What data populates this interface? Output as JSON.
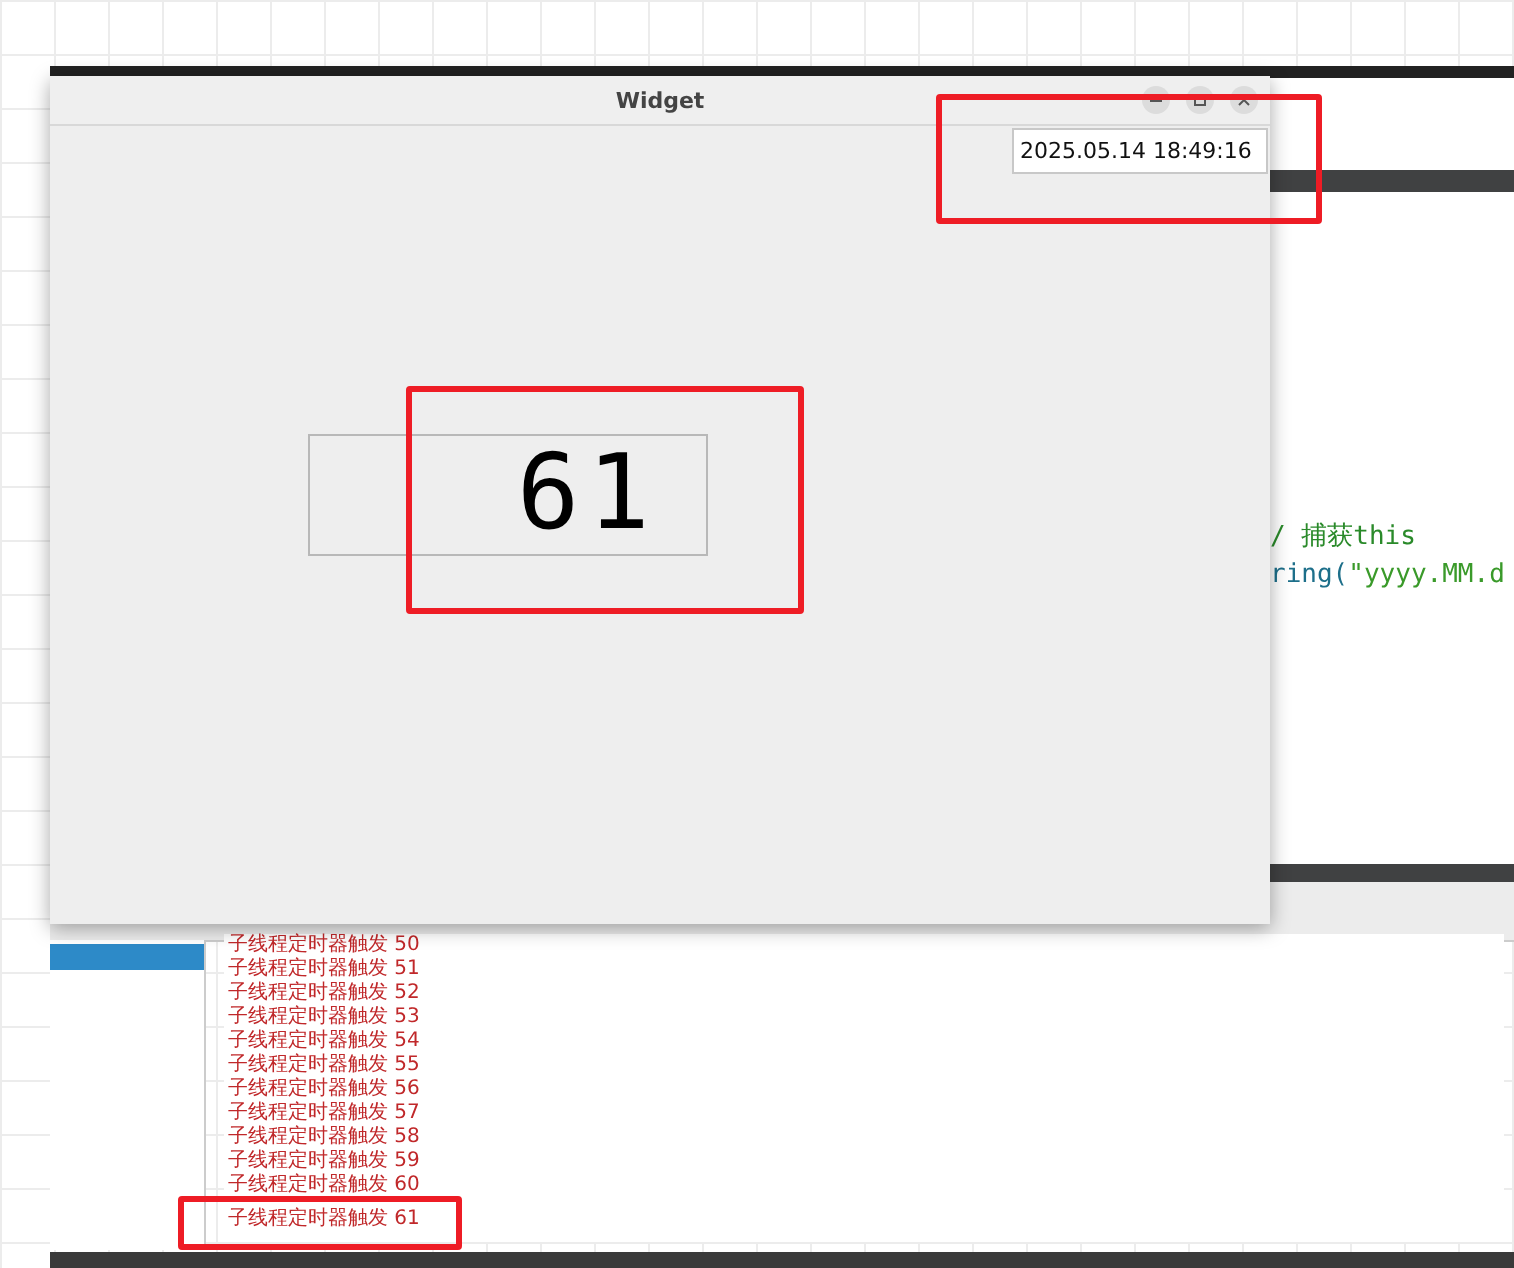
{
  "window": {
    "title": "Widget"
  },
  "datetime_field": {
    "value": "2025.05.14 18:49:16"
  },
  "lcd": {
    "value": "61"
  },
  "editor": {
    "lines": [
      [
        {
          "text": "/ 捕获this",
          "kind": "comment"
        }
      ],
      [
        {
          "text": "ring(",
          "kind": "code"
        },
        {
          "text": "\"yyyy.MM.d",
          "kind": "string"
        }
      ]
    ]
  },
  "output": {
    "lines": [
      "子线程定时器触发  50",
      "子线程定时器触发  51",
      "子线程定时器触发  52",
      "子线程定时器触发  53",
      "子线程定时器触发  54",
      "子线程定时器触发  55",
      "子线程定时器触发  56",
      "子线程定时器触发  57",
      "子线程定时器触发  58",
      "子线程定时器触发  59",
      "子线程定时器触发  60",
      "子线程定时器触发  61"
    ]
  }
}
